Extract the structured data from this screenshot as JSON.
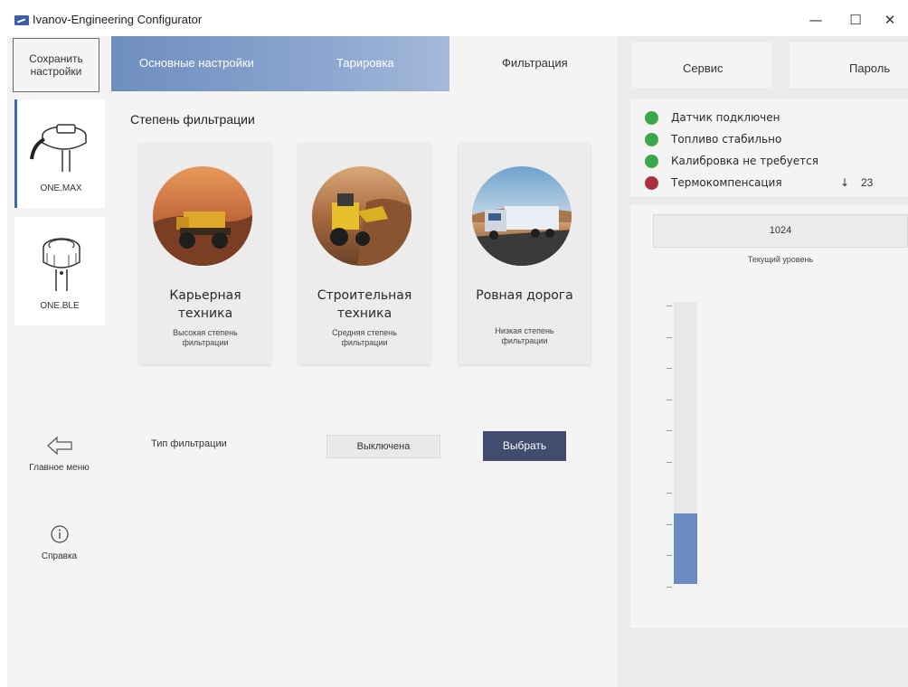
{
  "window": {
    "title": "Ivanov-Engineering Configurator",
    "controls": {
      "minimize": "—",
      "maximize": "☐",
      "close": "✕"
    }
  },
  "sidebar": {
    "save_label": "Сохранить\nнастройки",
    "devices": [
      {
        "label": "ONE.MAX",
        "selected": true
      },
      {
        "label": "ONE.BLE",
        "selected": false
      }
    ],
    "main_menu_label": "Главное меню",
    "help_label": "Справка"
  },
  "tabs": [
    {
      "label": "Основные настройки"
    },
    {
      "label": "Тарировка"
    },
    {
      "label": "Фильтрация",
      "active": true
    }
  ],
  "filtration": {
    "title": "Степень фильтрации",
    "cards": [
      {
        "title": "Карьерная\nтехника",
        "desc": "Высокая степень\nфильтрации",
        "image": "mining-truck"
      },
      {
        "title": "Строительная\nтехника",
        "desc": "Средняя степень\nфильтрации",
        "image": "construction-loader"
      },
      {
        "title": "Ровная дорога",
        "desc": "Низкая степень\nфильтрации",
        "image": "road-truck"
      }
    ],
    "type_label": "Тип фильтрации",
    "type_value": "Выключена",
    "select_label": "Выбрать"
  },
  "right_panel": {
    "tabs": [
      {
        "label": "Сервис"
      },
      {
        "label": "Пароль"
      }
    ],
    "status": [
      {
        "text": "Датчик подключен",
        "color": "#3aa64a"
      },
      {
        "text": "Топливо стабильно",
        "color": "#3aa64a"
      },
      {
        "text": "Калибровка не требуется",
        "color": "#3aa64a"
      },
      {
        "text": "Термокомпенсация",
        "color": "#a8323c"
      }
    ],
    "thermo_arrow": "↓",
    "thermo_value": "23",
    "level_value": "1024",
    "level_label": "Текущий уровень",
    "level_fill_fraction": 0.25
  },
  "colors": {
    "accent": "#424c6e",
    "tab_gradient_start": "#6e8ec0",
    "bar_fill": "#6a8cc0"
  }
}
